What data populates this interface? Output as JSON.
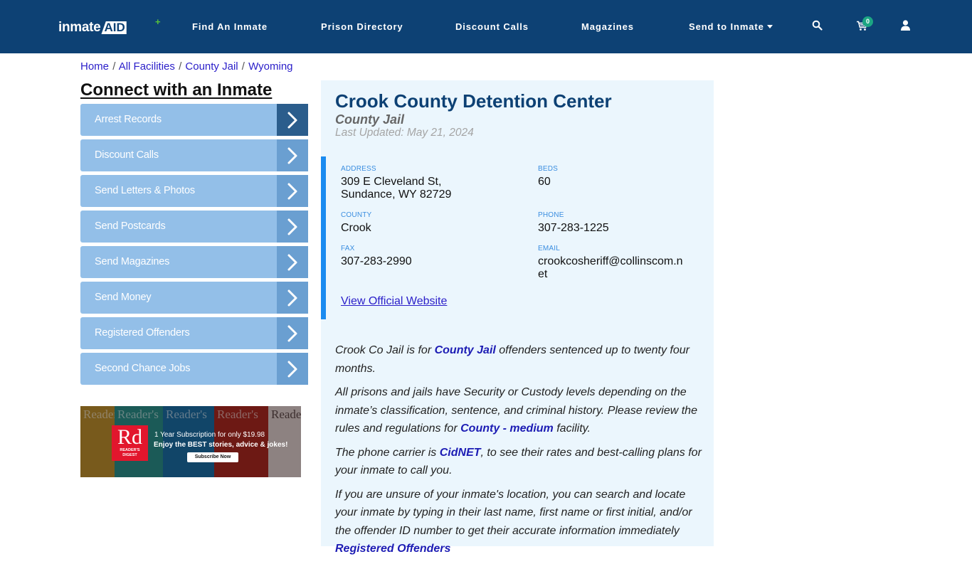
{
  "header": {
    "logo": {
      "part1": "inmate",
      "part2": "AID",
      "accent": "+"
    },
    "nav": [
      {
        "label": "Find An Inmate"
      },
      {
        "label": "Prison Directory"
      },
      {
        "label": "Discount Calls"
      },
      {
        "label": "Magazines"
      },
      {
        "label": "Send to Inmate",
        "has_dropdown": true
      }
    ],
    "icons": {
      "search": "search-icon",
      "cart": "cart-icon",
      "user": "user-icon"
    },
    "cart_count": "0",
    "colors": {
      "bar": "#0d4174",
      "badge": "#1ca583"
    }
  },
  "breadcrumb": {
    "items": [
      "Home",
      "All Facilities",
      "County Jail",
      "Wyoming"
    ],
    "separator": "/"
  },
  "sidebar": {
    "title": "Connect with an Inmate",
    "items": [
      {
        "label": "Arrest Records"
      },
      {
        "label": "Discount Calls"
      },
      {
        "label": "Send Letters & Photos"
      },
      {
        "label": "Send Postcards"
      },
      {
        "label": "Send Magazines"
      },
      {
        "label": "Send Money"
      },
      {
        "label": "Registered Offenders"
      },
      {
        "label": "Second Chance Jobs"
      }
    ],
    "ad": {
      "brand_big": "Rd",
      "brand_small_1": "READER'S",
      "brand_small_2": "DIGEST",
      "masthead": "Reader's",
      "line1": "1 Year Subscription for only $19.98",
      "line2": "Enjoy the BEST stories, advice & jokes!",
      "button": "Subscribe Now"
    }
  },
  "facility": {
    "name": "Crook County Detention Center",
    "type": "County Jail",
    "last_updated": "Last Updated: May 21, 2024",
    "fields": {
      "address_label": "ADDRESS",
      "address_line1": "309 E Cleveland St,",
      "address_line2": "Sundance, WY 82729",
      "beds_label": "BEDS",
      "beds": "60",
      "county_label": "COUNTY",
      "county": "Crook",
      "phone_label": "PHONE",
      "phone": "307-283-1225",
      "fax_label": "FAX",
      "fax": "307-283-2990",
      "email_label": "EMAIL",
      "email_line1": "crookcosheriff@collinscom.n",
      "email_line2": "et"
    },
    "website_link": "View Official Website"
  },
  "description": {
    "p1": {
      "before": "Crook Co Jail is for ",
      "link": "County Jail",
      "after": " offenders sentenced up to twenty four months."
    },
    "p2": {
      "before": "All prisons and jails have Security or Custody levels depending on the inmate’s classification, sentence, and criminal history. Please review the rules and regulations for ",
      "link": "County - medium",
      "after": " facility."
    },
    "p3": {
      "before": "The phone carrier is ",
      "link": "CidNET",
      "after": ", to see their rates and best-calling plans for your inmate to call you."
    },
    "p4": {
      "before": "If you are unsure of your inmate's location, you can search and locate your inmate by typing in their last name, first name or first initial, and/or the offender ID number to get their accurate information immediately ",
      "link": "Registered Offenders"
    }
  }
}
